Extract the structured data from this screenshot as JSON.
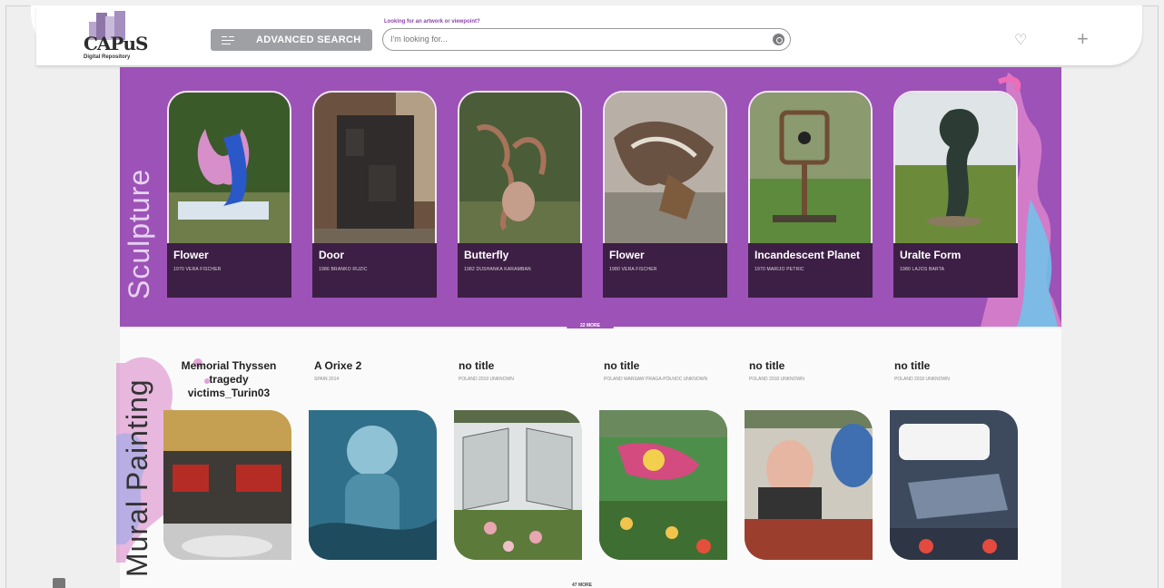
{
  "header": {
    "logo_word": "CAPuS",
    "logo_sub": "Digital Repository",
    "advanced_search": "ADVANCED SEARCH",
    "search_label": "Looking for an artwork or viewpoint?",
    "search_placeholder": "I'm looking for..."
  },
  "sculpture": {
    "title": "Sculpture",
    "more": "22 MORE",
    "items": [
      {
        "title": "Flower",
        "meta": "1970 VERA FISCHER"
      },
      {
        "title": "Door",
        "meta": "1986 BRANKO RUZIC"
      },
      {
        "title": "Butterfly",
        "meta": "1982 DUSHANKA KARAMBAN"
      },
      {
        "title": "Flower",
        "meta": "1980 VERA FISCHER"
      },
      {
        "title": "Incandescent Planet",
        "meta": "1970 MARIJO PETRIC"
      },
      {
        "title": "Uralte Form",
        "meta": "1980 LAJOS BARTA"
      }
    ]
  },
  "mural": {
    "title": "Mural Painting",
    "more": "47 MORE",
    "items": [
      {
        "title": "Memorial Thyssen tragedy victims_Turin03",
        "meta": ""
      },
      {
        "title": "A Orixe 2",
        "meta": "SPAIN 2014"
      },
      {
        "title": "no title",
        "meta": "POLAND 2019 UNKNOWN"
      },
      {
        "title": "no title",
        "meta": "POLAND WARSAW PRAGA-PÓŁNOC UNKNOWN"
      },
      {
        "title": "no title",
        "meta": "POLAND 2018 UNKNOWN"
      },
      {
        "title": "no title",
        "meta": "POLAND 2018 UNKNOWN"
      }
    ]
  },
  "colors": {
    "accent": "#9c52b7",
    "caption_bg": "#3d1e45"
  },
  "icons": [
    "filter-icon",
    "search-submit-icon",
    "heart-icon",
    "plus-icon",
    "settings-icon"
  ]
}
